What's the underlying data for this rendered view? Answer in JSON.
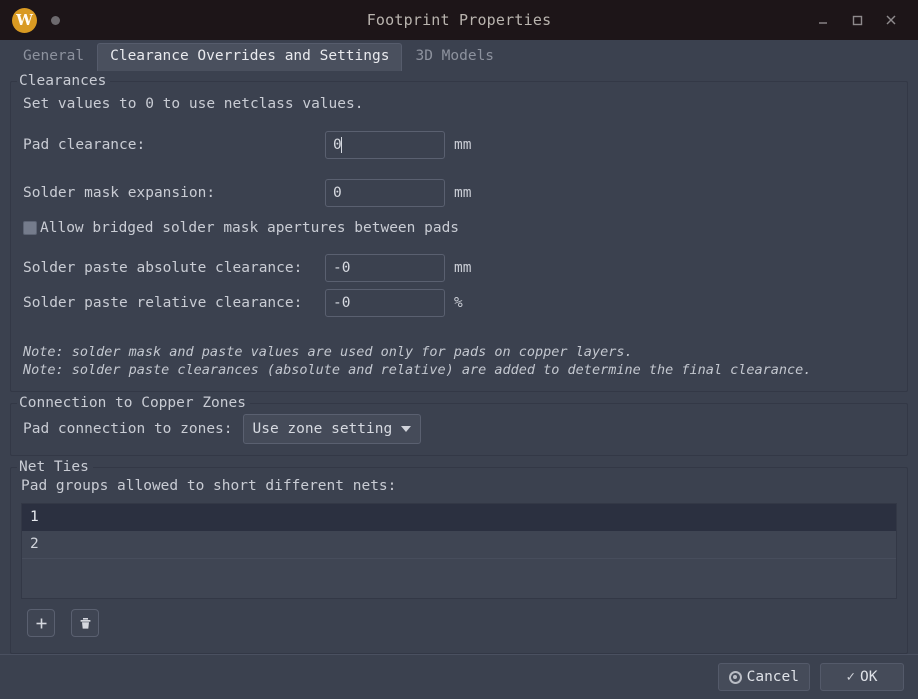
{
  "window": {
    "title": "Footprint Properties",
    "app_icon": "W",
    "controls": {
      "minimize": "minimize-icon",
      "maximize": "maximize-icon",
      "close": "close-icon"
    }
  },
  "tabs": [
    {
      "label": "General",
      "active": false
    },
    {
      "label": "Clearance Overrides and Settings",
      "active": true
    },
    {
      "label": "3D Models",
      "active": false
    }
  ],
  "clearances": {
    "legend": "Clearances",
    "hint": "Set values to 0 to use netclass values.",
    "pad_clearance": {
      "label": "Pad clearance:",
      "value": "0",
      "units": "mm"
    },
    "solder_mask_expansion": {
      "label": "Solder mask expansion:",
      "value": "0",
      "units": "mm"
    },
    "allow_bridged": {
      "label": "Allow bridged solder mask apertures between pads",
      "checked": false
    },
    "paste_absolute": {
      "label": "Solder paste absolute clearance:",
      "value": "-0",
      "units": "mm"
    },
    "paste_relative": {
      "label": "Solder paste relative clearance:",
      "value": "-0",
      "units": "%"
    },
    "note1": "Note: solder mask and paste values are used only for pads on copper layers.",
    "note2": "Note: solder paste clearances (absolute and relative) are added to determine the final clearance."
  },
  "copper_zones": {
    "legend": "Connection to Copper Zones",
    "pad_connection": {
      "label": "Pad connection to zones:",
      "selected": "Use zone setting"
    }
  },
  "net_ties": {
    "legend": "Net Ties",
    "hint": "Pad groups allowed to short different nets:",
    "rows": [
      {
        "value": "1",
        "selected": true
      },
      {
        "value": "2",
        "selected": false
      }
    ],
    "toolbar": {
      "add": "add-icon",
      "delete": "trash-icon"
    }
  },
  "footer": {
    "cancel": "Cancel",
    "ok": "OK"
  },
  "colors": {
    "window_bg": "#3b414f",
    "titlebar_bg": "#1d1518",
    "accent_icon": "#d99a22",
    "selected_row": "#2b3040",
    "text": "#c9ccd4"
  }
}
